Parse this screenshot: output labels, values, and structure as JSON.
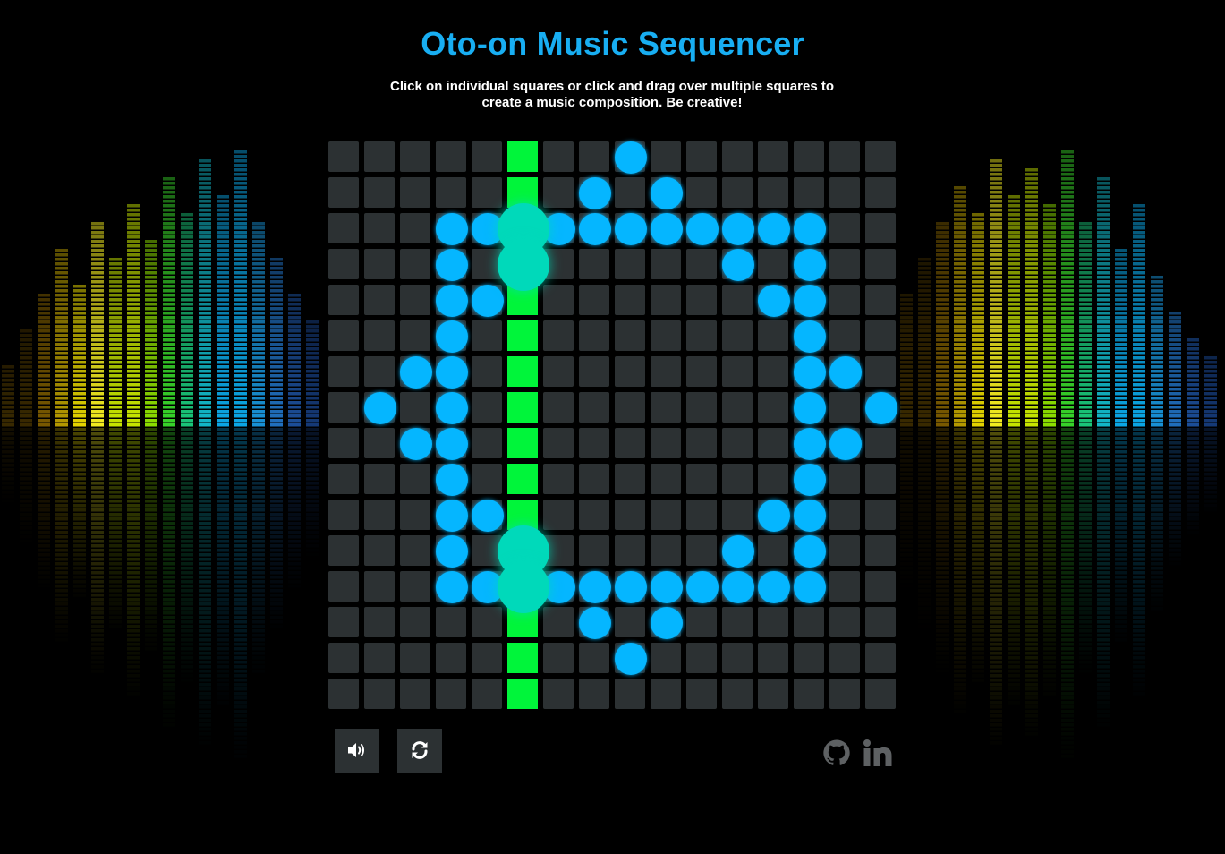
{
  "header": {
    "title": "Oto-on Music Sequencer",
    "instructions": "Click on individual squares or click and drag over multiple squares to create a music composition. Be creative!"
  },
  "sequencer": {
    "columns": 16,
    "rows": 16,
    "playhead_column": 5,
    "active_notes": [
      [
        0,
        8
      ],
      [
        1,
        7
      ],
      [
        1,
        9
      ],
      [
        2,
        3
      ],
      [
        2,
        4
      ],
      [
        2,
        5
      ],
      [
        2,
        6
      ],
      [
        2,
        7
      ],
      [
        2,
        8
      ],
      [
        2,
        9
      ],
      [
        2,
        10
      ],
      [
        2,
        11
      ],
      [
        2,
        12
      ],
      [
        2,
        13
      ],
      [
        3,
        3
      ],
      [
        3,
        5
      ],
      [
        3,
        11
      ],
      [
        3,
        13
      ],
      [
        4,
        3
      ],
      [
        4,
        4
      ],
      [
        4,
        12
      ],
      [
        4,
        13
      ],
      [
        5,
        3
      ],
      [
        5,
        13
      ],
      [
        6,
        2
      ],
      [
        6,
        3
      ],
      [
        6,
        13
      ],
      [
        6,
        14
      ],
      [
        7,
        1
      ],
      [
        7,
        3
      ],
      [
        7,
        13
      ],
      [
        7,
        15
      ],
      [
        8,
        2
      ],
      [
        8,
        3
      ],
      [
        8,
        13
      ],
      [
        8,
        14
      ],
      [
        9,
        3
      ],
      [
        9,
        13
      ],
      [
        10,
        3
      ],
      [
        10,
        4
      ],
      [
        10,
        12
      ],
      [
        10,
        13
      ],
      [
        11,
        3
      ],
      [
        11,
        5
      ],
      [
        11,
        11
      ],
      [
        11,
        13
      ],
      [
        12,
        3
      ],
      [
        12,
        4
      ],
      [
        12,
        5
      ],
      [
        12,
        6
      ],
      [
        12,
        7
      ],
      [
        12,
        8
      ],
      [
        12,
        9
      ],
      [
        12,
        10
      ],
      [
        12,
        11
      ],
      [
        12,
        12
      ],
      [
        12,
        13
      ],
      [
        13,
        7
      ],
      [
        13,
        9
      ],
      [
        14,
        8
      ]
    ],
    "playing_notes": [
      [
        2,
        5
      ],
      [
        3,
        5
      ],
      [
        11,
        5
      ],
      [
        12,
        5
      ]
    ]
  },
  "controls": {
    "mute_icon": "volume-icon",
    "reset_icon": "refresh-icon"
  },
  "social": {
    "github_icon": "github-icon",
    "linkedin_icon": "linkedin-icon"
  },
  "colors": {
    "title": "#18aef2",
    "cell": "#2c3133",
    "playhead": "#00f53a",
    "note": "#05b6ff",
    "note_playing": "#00d9ba",
    "social_icon": "#5e6163"
  }
}
